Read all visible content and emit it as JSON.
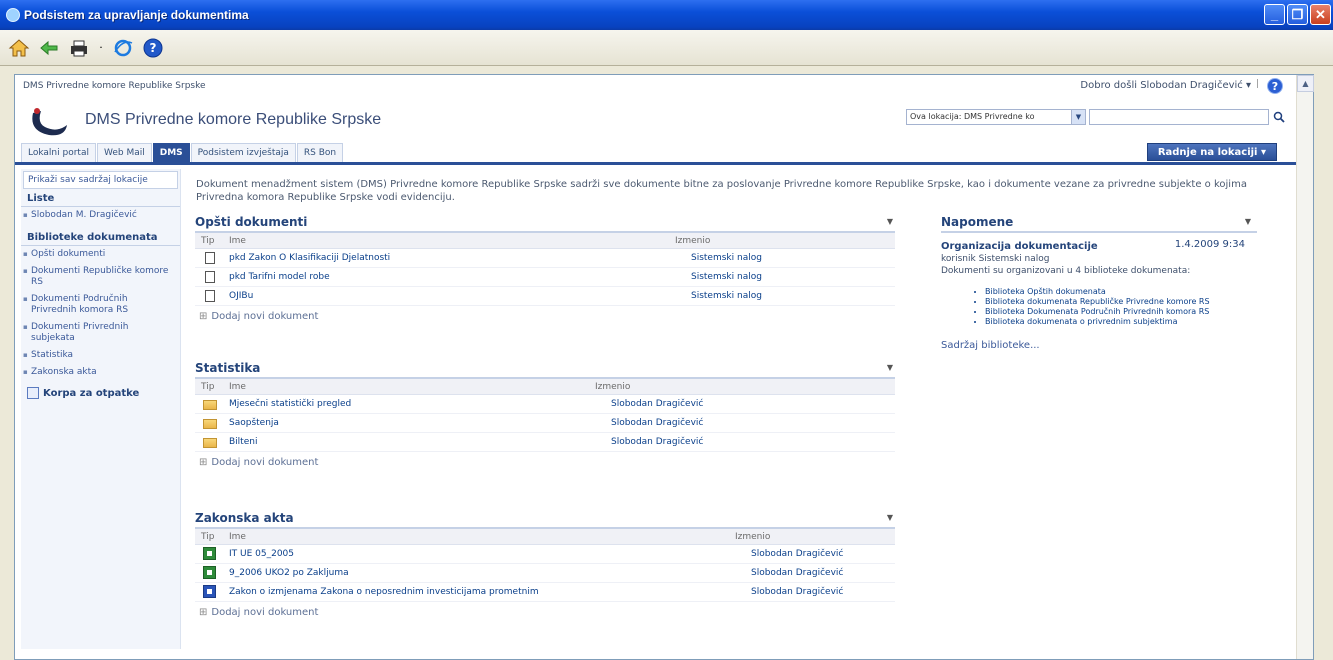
{
  "window": {
    "title": "Podsistem za upravljanje dokumentima"
  },
  "toolbar": {
    "icons": [
      "home-icon",
      "back-icon",
      "print-icon",
      "ie-icon",
      "help-icon"
    ]
  },
  "header": {
    "breadcrumb": "DMS Privredne komore Republike Srpske",
    "welcome": "Dobro došli Slobodan Dragičević ▾",
    "separator": "|",
    "site_title": "DMS Privredne komore Republike Srpske",
    "search_scope": "Ova lokacija: DMS Privredne ko"
  },
  "tabs": [
    {
      "label": "Lokalni portal",
      "active": false
    },
    {
      "label": "Web Mail",
      "active": false
    },
    {
      "label": "DMS",
      "active": true
    },
    {
      "label": "Podsistem izvještaja",
      "active": false
    },
    {
      "label": "RS Bon",
      "active": false
    }
  ],
  "site_actions": "Radnje na lokaciji ▾",
  "leftnav": {
    "view_all": "Prikaži sav sadržaj lokacije",
    "lists_heading": "Liste",
    "lists": [
      "Slobodan M. Dragičević"
    ],
    "libraries_heading": "Biblioteke dokumenata",
    "libraries": [
      "Opšti dokumenti",
      "Dokumenti Republičke komore RS",
      "Dokumenti Područnih Privrednih komora RS",
      "Dokumenti Privrednih subjekata",
      "Statistika",
      "Zakonska akta"
    ],
    "recycle": "Korpa za otpatke"
  },
  "intro": "Dokument menadžment sistem (DMS) Privredne komore Republike Srpske sadrži sve dokumente bitne za poslovanje Privredne komore Republike Srpske, kao i dokumente vezane za privredne subjekte o kojima Privredna komora Republike Srpske vodi evidenciju.",
  "webparts": {
    "opsti": {
      "title": "Opšti dokumenti",
      "col_type": "Tip",
      "col_name": "Ime",
      "col_modified": "Izmenio",
      "rows": [
        {
          "name": "pkd Zakon O Klasifikaciji Djelatnosti",
          "by": "Sistemski nalog"
        },
        {
          "name": "pkd Tarifni model robe",
          "by": "Sistemski nalog"
        },
        {
          "name": "OJIBu",
          "by": "Sistemski nalog"
        }
      ],
      "add_new": "Dodaj novi dokument"
    },
    "statistika": {
      "title": "Statistika",
      "col_type": "Tip",
      "col_name": "Ime",
      "col_modified": "Izmenio",
      "rows": [
        {
          "name": "Mjesečni statistički pregled",
          "by": "Slobodan Dragičević"
        },
        {
          "name": "Saopštenja",
          "by": "Slobodan Dragičević"
        },
        {
          "name": "Bilteni",
          "by": "Slobodan Dragičević"
        }
      ],
      "add_new": "Dodaj novi dokument"
    },
    "zakonska": {
      "title": "Zakonska akta",
      "col_type": "Tip",
      "col_name": "Ime",
      "col_modified": "Izmenio",
      "rows": [
        {
          "name": "IT UE 05_2005",
          "by": "Slobodan Dragičević"
        },
        {
          "name": "9_2006 UKO2 po Zakljuma",
          "by": "Slobodan Dragičević"
        },
        {
          "name": "Zakon o izmjenama Zakona o neposrednim investicijama prometnim",
          "by": "Slobodan Dragičević"
        }
      ],
      "add_new": "Dodaj novi dokument"
    }
  },
  "notes": {
    "title": "Napomene",
    "item_title": "Organizacija dokumentacije",
    "item_date": "1.4.2009 9:34",
    "item_author": "korisnik Sistemski nalog",
    "item_text": "Dokumenti su organizovani u 4 biblioteke dokumenata:",
    "items": [
      "Biblioteka Opštih dokumenata",
      "Biblioteka dokumenata Republičke Privredne komore RS",
      "Biblioteka Dokumenata Područnih Privrednih komora RS",
      "Biblioteka dokumenata o privrednim subjektima"
    ],
    "more": "Sadržaj biblioteke..."
  }
}
